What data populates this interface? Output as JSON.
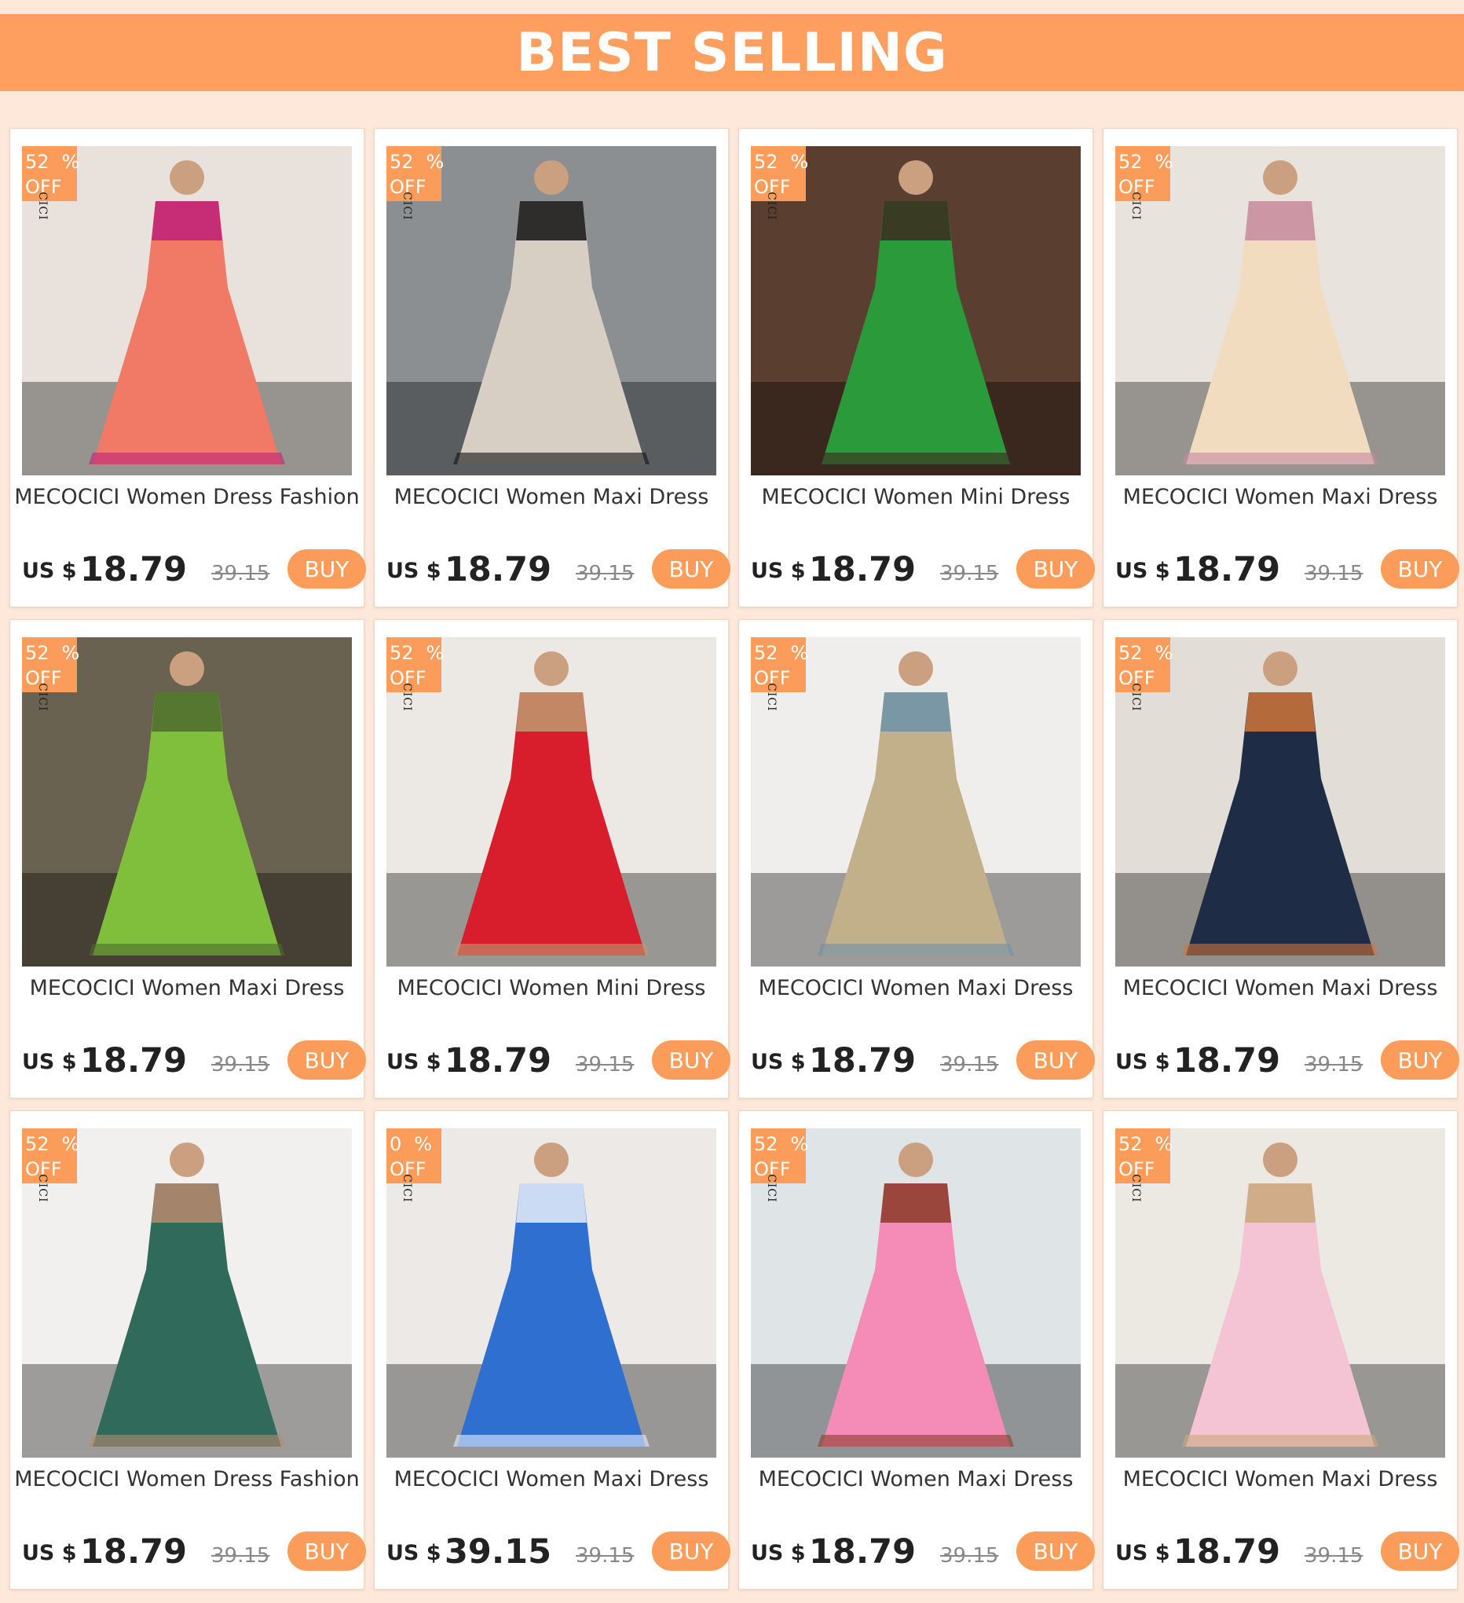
{
  "header": {
    "title": "BEST SELLING"
  },
  "products": [
    {
      "pct": "52",
      "pct_sym": "%",
      "off": "OFF",
      "brand": "CICI",
      "title": "MECOCICI Women Dress Fashion",
      "currency": "US $",
      "price": "18.79",
      "old_price": "39.15",
      "buy": "BUY",
      "dress_color": "#f07a66",
      "accent_color": "#c0207a",
      "bg_color": "#e9e2dc"
    },
    {
      "pct": "52",
      "pct_sym": "%",
      "off": "OFF",
      "brand": "CICI",
      "title": "MECOCICI Women Maxi Dress",
      "currency": "US $",
      "price": "18.79",
      "old_price": "39.15",
      "buy": "BUY",
      "dress_color": "#d8cfc4",
      "accent_color": "#111111",
      "bg_color": "#8b8f92"
    },
    {
      "pct": "52",
      "pct_sym": "%",
      "off": "OFF",
      "brand": "CICI",
      "title": "MECOCICI Women Mini Dress",
      "currency": "US $",
      "price": "18.79",
      "old_price": "39.15",
      "buy": "BUY",
      "dress_color": "#2a9a3a",
      "accent_color": "#3c2a20",
      "bg_color": "#5a3e30"
    },
    {
      "pct": "52",
      "pct_sym": "%",
      "off": "OFF",
      "brand": "CICI",
      "title": "MECOCICI Women Maxi Dress",
      "currency": "US $",
      "price": "18.79",
      "old_price": "39.15",
      "buy": "BUY",
      "dress_color": "#f1dcc0",
      "accent_color": "#c78aa0",
      "bg_color": "#e8e3dc"
    },
    {
      "pct": "52",
      "pct_sym": "%",
      "off": "OFF",
      "brand": "CICI",
      "title": "MECOCICI Women Maxi Dress",
      "currency": "US $",
      "price": "18.79",
      "old_price": "39.15",
      "buy": "BUY",
      "dress_color": "#7fbf3c",
      "accent_color": "#4f6a2e",
      "bg_color": "#6a6250"
    },
    {
      "pct": "52",
      "pct_sym": "%",
      "off": "OFF",
      "brand": "CICI",
      "title": "MECOCICI Women Mini Dress",
      "currency": "US $",
      "price": "18.79",
      "old_price": "39.15",
      "buy": "BUY",
      "dress_color": "#d81e2c",
      "accent_color": "#c09a70",
      "bg_color": "#ece8e4"
    },
    {
      "pct": "52",
      "pct_sym": "%",
      "off": "OFF",
      "brand": "CICI",
      "title": "MECOCICI Women Maxi Dress",
      "currency": "US $",
      "price": "18.79",
      "old_price": "39.15",
      "buy": "BUY",
      "dress_color": "#c2b08a",
      "accent_color": "#6c93a8",
      "bg_color": "#f0eeec"
    },
    {
      "pct": "52",
      "pct_sym": "%",
      "off": "OFF",
      "brand": "CICI",
      "title": "MECOCICI Women Maxi Dress",
      "currency": "US $",
      "price": "18.79",
      "old_price": "39.15",
      "buy": "BUY",
      "dress_color": "#1f2c45",
      "accent_color": "#d0753a",
      "bg_color": "#e2ddd6"
    },
    {
      "pct": "52",
      "pct_sym": "%",
      "off": "OFF",
      "brand": "CICI",
      "title": "MECOCICI Women Dress Fashion",
      "currency": "US $",
      "price": "18.79",
      "old_price": "39.15",
      "buy": "BUY",
      "dress_color": "#2f6a5a",
      "accent_color": "#b98a70",
      "bg_color": "#f1f0ee"
    },
    {
      "pct": "0",
      "pct_sym": "%",
      "off": "OFF",
      "brand": "CICI",
      "title": "MECOCICI Women Maxi Dress",
      "currency": "US $",
      "price": "39.15",
      "old_price": "39.15",
      "buy": "BUY",
      "dress_color": "#2f6fd0",
      "accent_color": "#e8eefa",
      "bg_color": "#ece9e6"
    },
    {
      "pct": "52",
      "pct_sym": "%",
      "off": "OFF",
      "brand": "CICI",
      "title": "MECOCICI Women Maxi Dress",
      "currency": "US $",
      "price": "18.79",
      "old_price": "39.15",
      "buy": "BUY",
      "dress_color": "#f58cb8",
      "accent_color": "#8a3a26",
      "bg_color": "#dfe4e6"
    },
    {
      "pct": "52",
      "pct_sym": "%",
      "off": "OFF",
      "brand": "CICI",
      "title": "MECOCICI Women Maxi Dress",
      "currency": "US $",
      "price": "18.79",
      "old_price": "39.15",
      "buy": "BUY",
      "dress_color": "#f4c4d4",
      "accent_color": "#c9a87a",
      "bg_color": "#ece8e2"
    }
  ]
}
